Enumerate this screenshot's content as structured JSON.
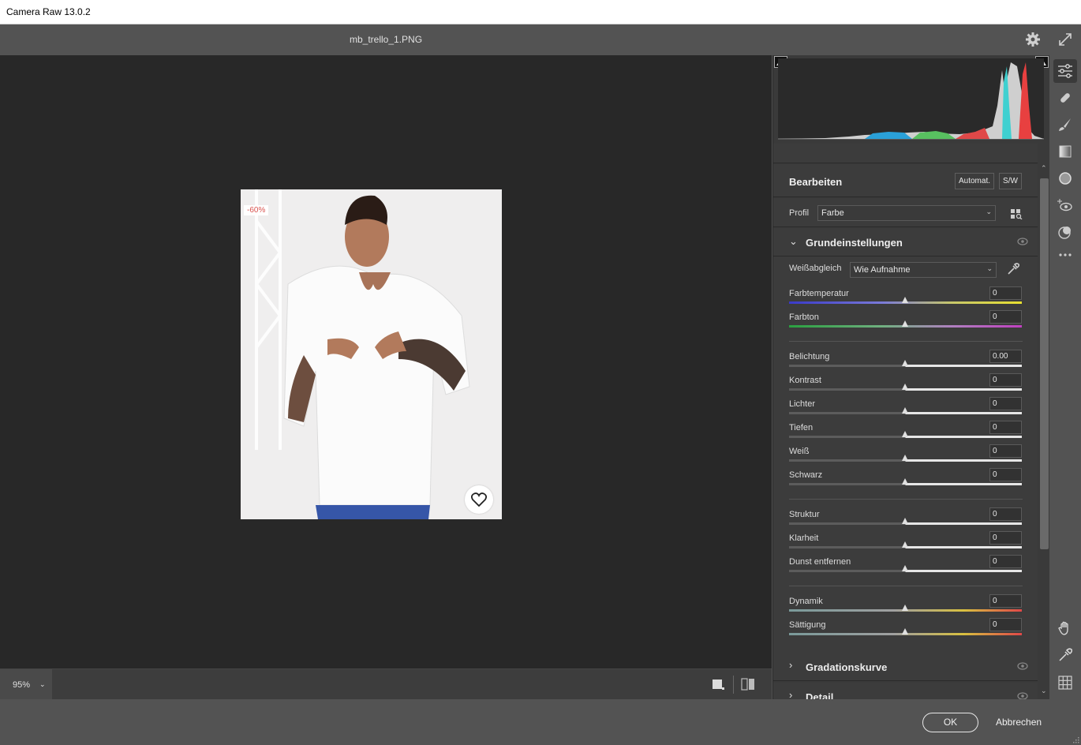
{
  "window": {
    "title": "Camera Raw 13.0.2"
  },
  "header": {
    "filename": "mb_trello_1.PNG"
  },
  "image": {
    "discount_badge": "-60%"
  },
  "bottombar": {
    "zoom": "95%"
  },
  "footer": {
    "ok_label": "OK",
    "cancel_label": "Abbrechen"
  },
  "panel": {
    "edit_title": "Bearbeiten",
    "auto_label": "Automat.",
    "bw_label": "S/W",
    "profile_label": "Profil",
    "profile_value": "Farbe",
    "sections": {
      "basic": "Grundeinstellungen",
      "curve": "Gradationskurve",
      "detail": "Detail"
    },
    "wb_label": "Weißabgleich",
    "wb_value": "Wie Aufnahme",
    "sliders": [
      {
        "label": "Farbtemperatur",
        "value": "0"
      },
      {
        "label": "Farbton",
        "value": "0"
      },
      {
        "label": "Belichtung",
        "value": "0.00"
      },
      {
        "label": "Kontrast",
        "value": "0"
      },
      {
        "label": "Lichter",
        "value": "0"
      },
      {
        "label": "Tiefen",
        "value": "0"
      },
      {
        "label": "Weiß",
        "value": "0"
      },
      {
        "label": "Schwarz",
        "value": "0"
      },
      {
        "label": "Struktur",
        "value": "0"
      },
      {
        "label": "Klarheit",
        "value": "0"
      },
      {
        "label": "Dunst entfernen",
        "value": "0"
      },
      {
        "label": "Dynamik",
        "value": "0"
      },
      {
        "label": "Sättigung",
        "value": "0"
      }
    ]
  },
  "icons": {
    "header": [
      "gear-icon",
      "expand-icon"
    ],
    "tools": [
      "edit-sliders-icon",
      "healing-icon",
      "brush-icon",
      "gradient-icon",
      "radial-icon",
      "redeye-icon",
      "presets-icon",
      "more-icon",
      "hand-icon",
      "eyedropper-icon",
      "grid-icon"
    ]
  }
}
